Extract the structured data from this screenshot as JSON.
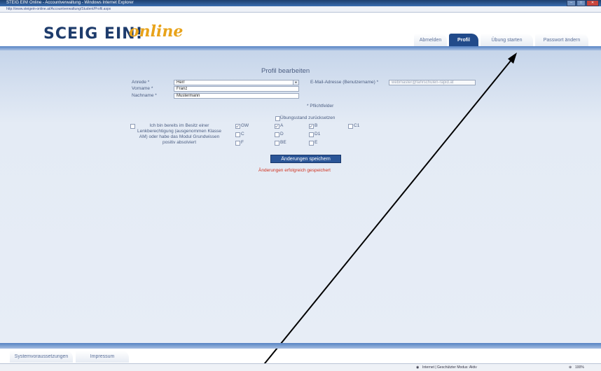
{
  "window": {
    "title": "STEIG EIN! Online - Accountverwaltung - Windows Internet Explorer",
    "url": "http://www.steigein-online.at/Accountverwaltung/Student/Profil.aspx"
  },
  "brand": {
    "logo": "SCEIG EIN!",
    "script": "online"
  },
  "nav": {
    "tabs": [
      {
        "label": "Abmelden"
      },
      {
        "label": "Profil"
      },
      {
        "label": "Übung starten"
      },
      {
        "label": "Passwort ändern"
      }
    ]
  },
  "form": {
    "title": "Profil bearbeiten",
    "anrede_label": "Anrede *",
    "anrede_value": "Herr",
    "vorname_label": "Vorname *",
    "vorname_value": "Franz",
    "nachname_label": "Nachname *",
    "nachname_value": "Mustermann",
    "email_label": "E-Mail-Adresse (Benutzername) *",
    "email_value": "webmaster@fahrschulen-rapid.at",
    "required_note": "* Pflichtfelder",
    "reset_label": "Übungsstand zurücksetzen",
    "license_text": "Ich bin bereits im Besitz einer Lenkberechtigung (ausgenommen Klasse AM) oder habe das Modul Grundwissen positiv absolviert",
    "classes": [
      {
        "label": "GW",
        "checked": true
      },
      {
        "label": "A",
        "checked": true
      },
      {
        "label": "B",
        "checked": true
      },
      {
        "label": "C1",
        "checked": false
      },
      {
        "label": "C",
        "checked": false
      },
      {
        "label": "D",
        "checked": false
      },
      {
        "label": "D1",
        "checked": false
      },
      {
        "label": "F",
        "checked": false
      },
      {
        "label": "BE",
        "checked": false
      },
      {
        "label": "E",
        "checked": false
      }
    ],
    "save_button": "Änderungen speichern",
    "success_message": "Änderungen erfolgreich gespeichert"
  },
  "footer": {
    "links": [
      {
        "label": "Systemvoraussetzungen"
      },
      {
        "label": "Impressum"
      }
    ]
  },
  "statusbar": {
    "zone": "Internet | Geschützter Modus: Aktiv",
    "zoom": "100%"
  }
}
